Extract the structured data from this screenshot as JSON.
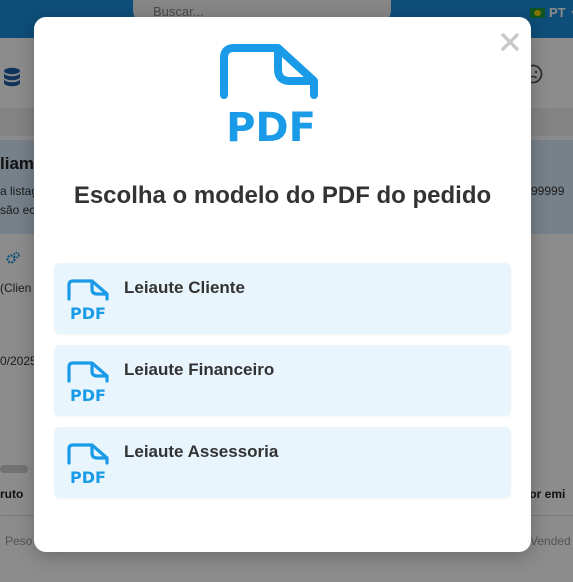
{
  "background": {
    "search_placeholder": "Buscar...",
    "language": "PT",
    "info_title": "liam",
    "info_line1": "a listag",
    "info_line2": "são ec",
    "info_right": "99999",
    "client_field": "(Clien",
    "date_field": "0/2025",
    "col_left": "ruto",
    "col_right": "lor emi",
    "filter_left": "Peso",
    "filter_right": "Vended"
  },
  "modal": {
    "title": "Escolha o modelo do PDF do pedido",
    "close_icon": "close-icon",
    "hero_icon": "pdf-file-icon",
    "options": [
      {
        "label": "Leiaute Cliente",
        "icon": "pdf-file-icon"
      },
      {
        "label": "Leiaute Financeiro",
        "icon": "pdf-file-icon"
      },
      {
        "label": "Leiaute Assessoria",
        "icon": "pdf-file-icon"
      }
    ]
  },
  "colors": {
    "accent_blue": "#1a9be8",
    "header_blue": "#1a8fdd",
    "option_background": "#e8f5fd",
    "title_text": "#333333"
  }
}
